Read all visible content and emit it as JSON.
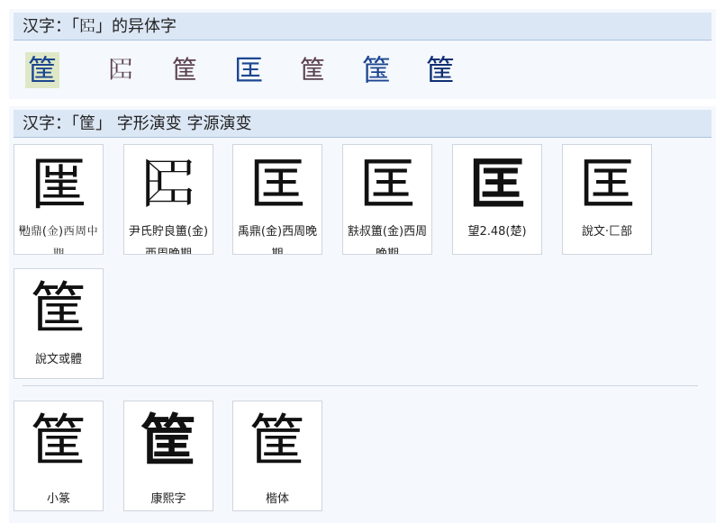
{
  "section1": {
    "title": "汉字：「𠥓」的异体字",
    "variants": [
      "筐",
      "𠥓",
      "筐",
      "匡",
      "筐",
      "筺",
      "筐"
    ]
  },
  "section2": {
    "title": "汉字：「筐」 字形演变 字源演变",
    "evolution": [
      {
        "glyph": "匩",
        "caption": "𠣈鼎(金)西周中期"
      },
      {
        "glyph": "𠥓",
        "caption": "尹氏貯良簠(金)西周晚期"
      },
      {
        "glyph": "匡",
        "caption": "禹鼎(金)西周晚期"
      },
      {
        "glyph": "匡",
        "caption": "㝬叔簠(金)西周晚期"
      },
      {
        "glyph": "匡",
        "caption": "望2.48(楚)"
      },
      {
        "glyph": "匡",
        "caption": "說文·匚部"
      },
      {
        "glyph": "筐",
        "caption": "說文或體"
      }
    ],
    "scripts": [
      {
        "glyph": "筐",
        "caption": "小篆"
      },
      {
        "glyph": "筐",
        "caption": "康熙字"
      },
      {
        "glyph": "筐",
        "caption": "楷体"
      }
    ]
  }
}
